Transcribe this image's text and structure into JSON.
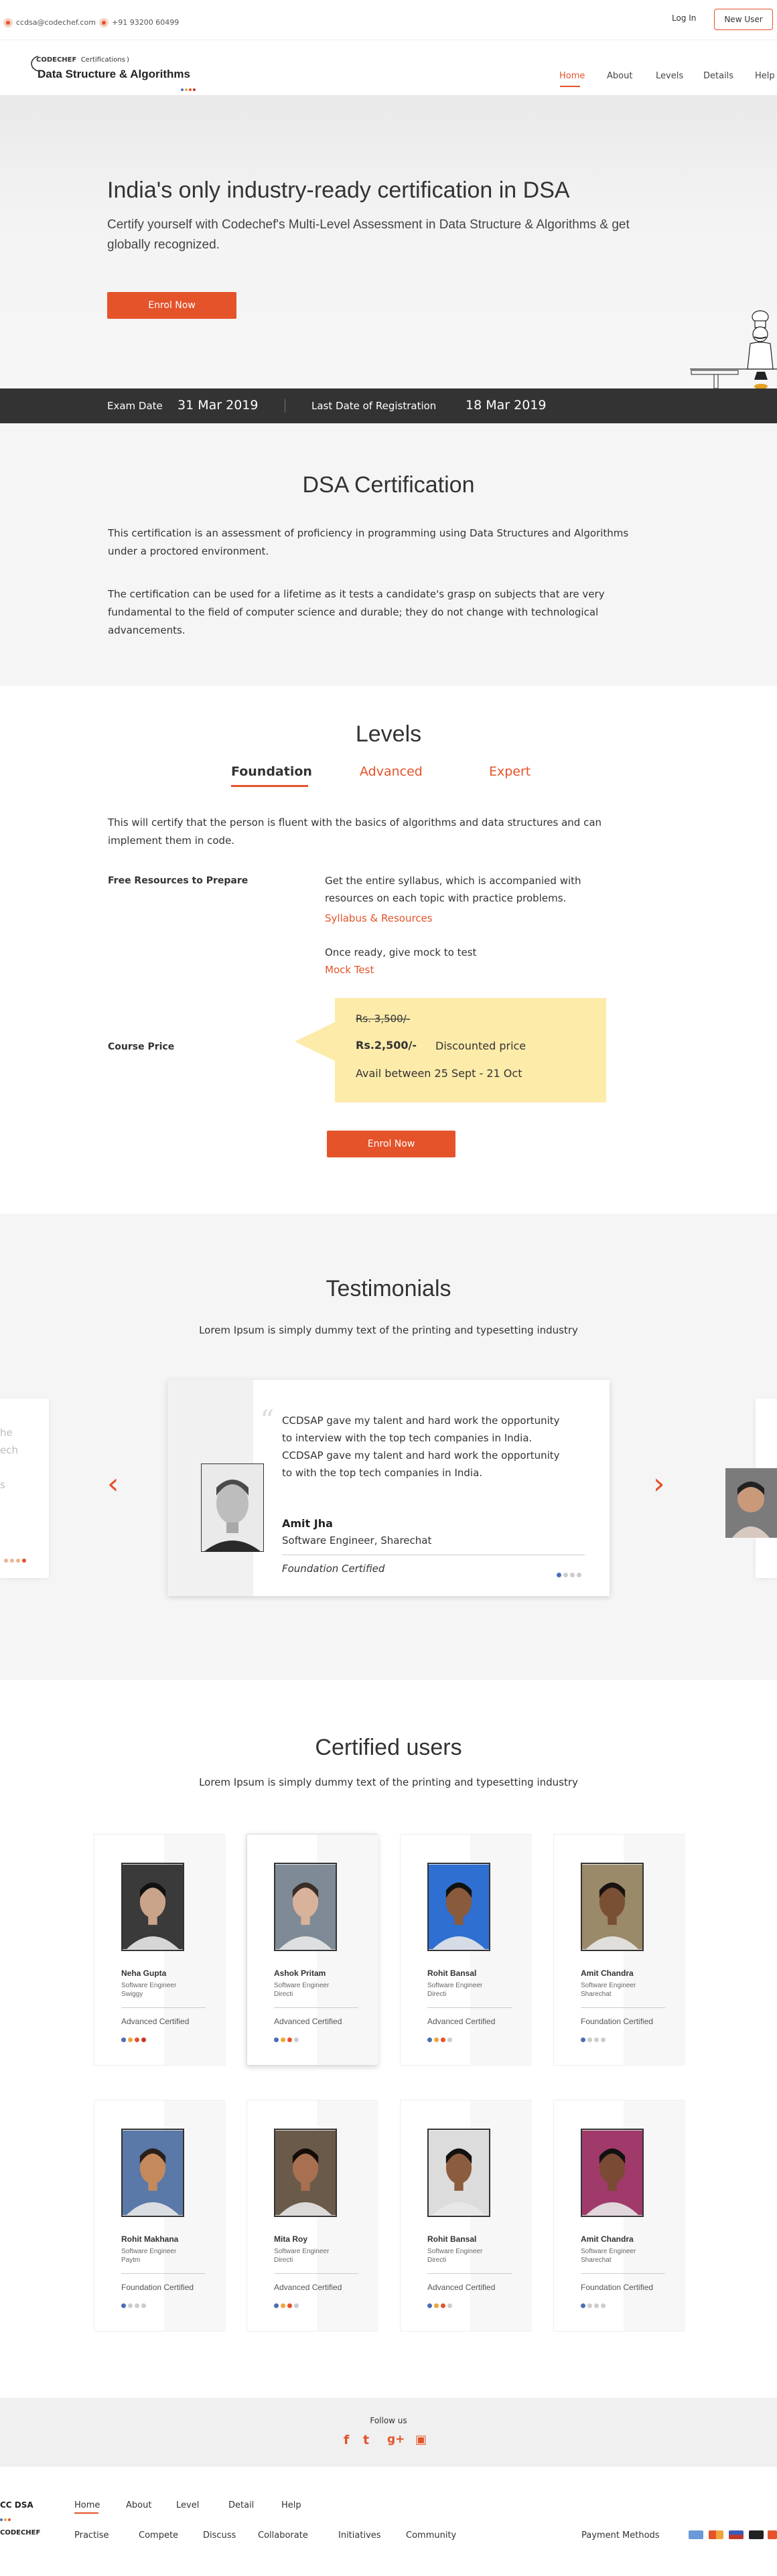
{
  "topbar": {
    "email": "ccdsa@codechef.com",
    "phone": "+91 93200 60499",
    "login": "Log In",
    "new_user": "New User"
  },
  "nav": {
    "brand_prefix": "CODECHEF",
    "brand_suffix": "Certifications",
    "brand_title": "Data Structure & Algorithms",
    "items": [
      "Home",
      "About",
      "Levels",
      "Details",
      "Help"
    ],
    "active": "Home"
  },
  "hero": {
    "title": "India's only industry-ready certification in DSA",
    "subtitle": "Certify yourself with Codechef's Multi-Level Assessment in Data Structure & Algorithms & get globally recognized.",
    "cta": "Enrol Now"
  },
  "exam_bar": {
    "exam_date_label": "Exam Date",
    "exam_date": "31 Mar 2019",
    "reg_label": "Last Date of Registration",
    "reg_date": "18 Mar 2019"
  },
  "dsa": {
    "title": "DSA Certification",
    "para1": "This certification is an assessment of proficiency in programming using Data Structures and Algorithms under a proctored environment.",
    "para2": "The certification can be used for a lifetime as it tests a candidate's grasp on subjects that are very fundamental to the field of computer science and durable; they do not change with technological advancements."
  },
  "levels": {
    "title": "Levels",
    "tabs": [
      "Foundation",
      "Advanced",
      "Expert"
    ],
    "description": "This will certify that the person is fluent with the basics of algorithms and data structures and can implement them in code.",
    "resources_label": "Free Resources to Prepare",
    "resources_text": "Get the entire syllabus, which is accompanied with resources on each topic with practice problems.",
    "syllabus_link": "Syllabus & Resources",
    "mock_text": "Once ready, give mock to test",
    "mock_link": "Mock Test",
    "price_label": "Course Price",
    "old_price": "Rs. 3,500/-",
    "new_price": "Rs.2,500/-",
    "discount_label": "Discounted price",
    "availability": "Avail between 25 Sept - 21 Oct",
    "cta": "Enrol Now"
  },
  "testimonials": {
    "title": "Testimonials",
    "subtitle": "Lorem Ipsum is simply dummy text of the printing and typesetting industry",
    "quote_mark": "“",
    "quote": "CCDSAP gave my talent and hard work the opportunity to interview with the top tech companies in India. CCDSAP gave my talent and hard work the opportunity to with the top tech companies in India.",
    "name": "Amit Jha",
    "role": "Software Engineer, Sharechat",
    "certification": "Foundation Certified",
    "ghost_left_lines": [
      "he",
      "ech",
      "",
      "s"
    ],
    "prev_arrow": "‹",
    "next_arrow": "›"
  },
  "certified": {
    "title": "Certified users",
    "subtitle": "Lorem Ipsum is simply dummy text of the printing and typesetting industry",
    "users": [
      {
        "name": "Neha Gupta",
        "role": "Software Engineer",
        "company": "Swiggy",
        "level": "Advanced Certified",
        "dots": [
          "#4a6fb5",
          "#f0a43a",
          "#e4532a",
          "#c0392b"
        ],
        "skin": "#c9a48a",
        "bg": "#3a3a3a",
        "hair": "#111"
      },
      {
        "name": "Ashok Pritam",
        "role": "Software Engineer",
        "company": "Directi",
        "level": "Advanced Certified",
        "dots": [
          "#4a6fb5",
          "#f0a43a",
          "#e4532a",
          "#cccccc"
        ],
        "skin": "#d8b29a",
        "bg": "#7e8a95",
        "hair": "#3a2e28"
      },
      {
        "name": "Rohit Bansal",
        "role": "Software Engineer",
        "company": "Directi",
        "level": "Advanced Certified",
        "dots": [
          "#4a6fb5",
          "#f0a43a",
          "#e4532a",
          "#cccccc"
        ],
        "skin": "#8a5a3c",
        "bg": "#2e6fd1",
        "hair": "#111"
      },
      {
        "name": "Amit Chandra",
        "role": "Software Engineer",
        "company": "Sharechat",
        "level": "Foundation Certified",
        "dots": [
          "#4a6fb5",
          "#cccccc",
          "#cccccc",
          "#cccccc"
        ],
        "skin": "#7a5035",
        "bg": "#9a8a6a",
        "hair": "#1a120e"
      },
      {
        "name": "Rohit Makhana",
        "role": "Software Engineer",
        "company": "Paytm",
        "level": "Foundation Certified",
        "dots": [
          "#4a6fb5",
          "#cccccc",
          "#cccccc",
          "#cccccc"
        ],
        "skin": "#c48a5c",
        "bg": "#5a78a8",
        "hair": "#2a1e18"
      },
      {
        "name": "Mita Roy",
        "role": "Software Engineer",
        "company": "Directi",
        "level": "Advanced Certified",
        "dots": [
          "#4a6fb5",
          "#f0a43a",
          "#e4532a",
          "#cccccc"
        ],
        "skin": "#a87050",
        "bg": "#6a5a4a",
        "hair": "#140c08"
      },
      {
        "name": "Rohit Bansal",
        "role": "Software Engineer",
        "company": "Directi",
        "level": "Advanced Certified",
        "dots": [
          "#4a6fb5",
          "#f0a43a",
          "#e4532a",
          "#cccccc"
        ],
        "skin": "#8c5c3e",
        "bg": "#dcdcdc",
        "hair": "#111"
      },
      {
        "name": "Amit Chandra",
        "role": "Software Engineer",
        "company": "Sharechat",
        "level": "Foundation Certified",
        "dots": [
          "#4a6fb5",
          "#cccccc",
          "#cccccc",
          "#cccccc"
        ],
        "skin": "#7a4a34",
        "bg": "#a03a6a",
        "hair": "#111"
      }
    ]
  },
  "footer": {
    "follow_us": "Follow us",
    "social_icons": [
      "facebook-icon",
      "twitter-icon",
      "google-plus-icon",
      "instagram-icon"
    ],
    "social_glyphs": [
      "f",
      "t",
      "g+",
      "▣"
    ],
    "logo_top": "CC DSA",
    "logo_bottom": "CODECHEF",
    "links_row1": [
      "Home",
      "About",
      "Level",
      "Detail",
      "Help"
    ],
    "links_row2": [
      "Practise",
      "Compete",
      "Discuss",
      "Collaborate",
      "Initiatives",
      "Community"
    ],
    "payment_label": "Payment Methods"
  },
  "colors": {
    "accent": "#e4532a",
    "price_box": "#fdebaa",
    "exam_bar": "#333333",
    "section_gray": "#f5f5f5"
  }
}
